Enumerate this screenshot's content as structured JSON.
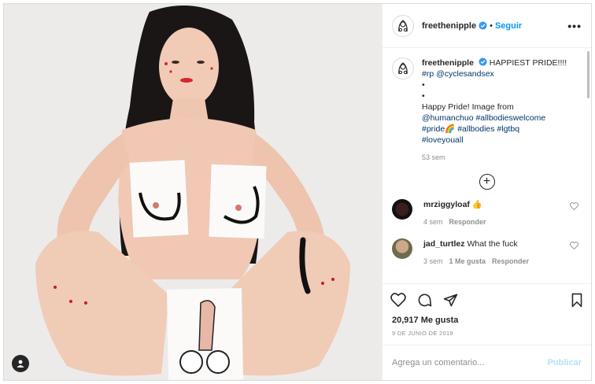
{
  "header": {
    "username": "freethenipple",
    "separator": "•",
    "follow_label": "Seguir",
    "more_label": "•••"
  },
  "caption": {
    "username": "freethenipple",
    "headline": "HAPPIEST PRIDE!!!!",
    "line_rp": "#rp @cyclesandsex",
    "dots_1": "•",
    "dots_2": "•",
    "text": "Happy Pride! Image from",
    "mention": "@humanchuo",
    "tag_1": "#allbodieswelcome",
    "tag_pride": "#pride",
    "rainbow_emoji": "🌈",
    "tag_2": "#allbodies",
    "tag_3": "#lgtbq",
    "tag_4": "#loveyouall",
    "time": "53 sem"
  },
  "comments": [
    {
      "username": "mrziggyloaf",
      "text": "👍",
      "time": "4 sem",
      "reply": "Responder",
      "likes": ""
    },
    {
      "username": "jad_turtlez",
      "text": "What the fuck",
      "time": "3 sem",
      "likes": "1 Me gusta",
      "reply": "Responder"
    }
  ],
  "stats": {
    "likes": "20,917 Me gusta",
    "date": "9 DE JUNIO DE 2019"
  },
  "composer": {
    "placeholder": "Agrega un comentario...",
    "publish_label": "Publicar"
  },
  "icons": {
    "verified": "verified-badge-icon",
    "like": "heart-icon",
    "comment": "comment-icon",
    "share": "paper-plane-icon",
    "save": "bookmark-icon",
    "add": "plus-circle-icon",
    "tag": "user-tag-icon"
  },
  "colors": {
    "accent": "#0095f6",
    "verified": "#3897f0",
    "muted": "#8e8e8e",
    "publish_disabled": "#b2dffc",
    "text": "#262626"
  }
}
